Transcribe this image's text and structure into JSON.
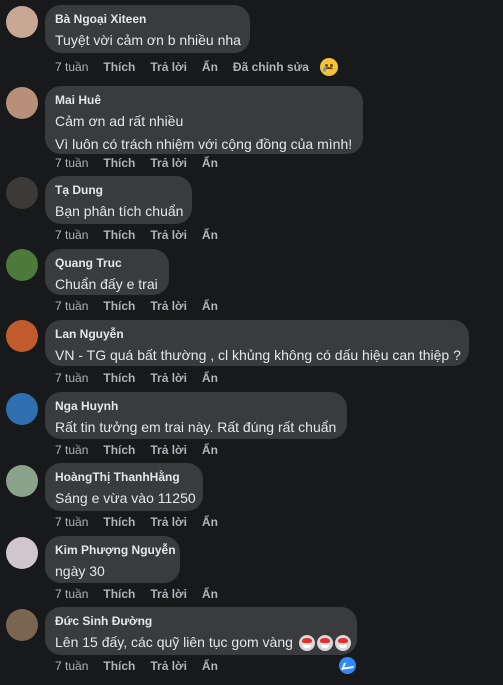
{
  "actions": {
    "like": "Thích",
    "reply": "Trả lời",
    "hide": "Ẩn",
    "edited": "Đã chỉnh sửa"
  },
  "comments": [
    {
      "author": "Bà Ngoại Xiteen",
      "lines": [
        "Tuyệt vời cảm ơn b nhiều nha"
      ],
      "time": "7 tuần",
      "avatar_color": "#c9a795"
    },
    {
      "author": "Mai Huê",
      "lines": [
        "Cảm ơn ad rất nhiều",
        "Vì luôn có trách nhiệm với cộng đồng của mình!"
      ],
      "time": "7 tuần",
      "avatar_color": "#b8907a"
    },
    {
      "author": "Tạ Dung",
      "lines": [
        "Bạn phân tích chuẩn"
      ],
      "time": "7 tuần",
      "avatar_color": "#3b3a38"
    },
    {
      "author": "Quang Truc",
      "lines": [
        "Chuẩn đấy e trai"
      ],
      "time": "7 tuần",
      "avatar_color": "#4c7a3a"
    },
    {
      "author": "Lan Nguyễn",
      "lines": [
        "VN - TG quá bất thường , cl khủng không có dấu hiệu can thiệp ?"
      ],
      "time": "7 tuần",
      "avatar_color": "#c25b2c"
    },
    {
      "author": "Nga Huynh",
      "lines": [
        "Rất tin tưởng em trai này. Rất đúng rất chuẩn"
      ],
      "time": "7 tuần",
      "avatar_color": "#2f6fb0"
    },
    {
      "author": "HoàngThị ThanhHằng",
      "lines": [
        "Sáng e vừa vào 11250"
      ],
      "time": "7 tuần",
      "avatar_color": "#8aa38a"
    },
    {
      "author": "Kim Phượng Nguyễn",
      "lines": [
        "ngày 30"
      ],
      "time": "7 tuần",
      "avatar_color": "#cfc7cc"
    },
    {
      "author": "Đức Sinh Đường",
      "lines": [
        "Lên 15 đấy, các quỹ liên tục gom vàng"
      ],
      "time": "7 tuần",
      "avatar_color": "#7a6650"
    }
  ],
  "icons": {
    "reaction": "sad-reaction-icon",
    "emoji": "clown-face-emoji",
    "messenger": "reply-bubble-icon"
  }
}
